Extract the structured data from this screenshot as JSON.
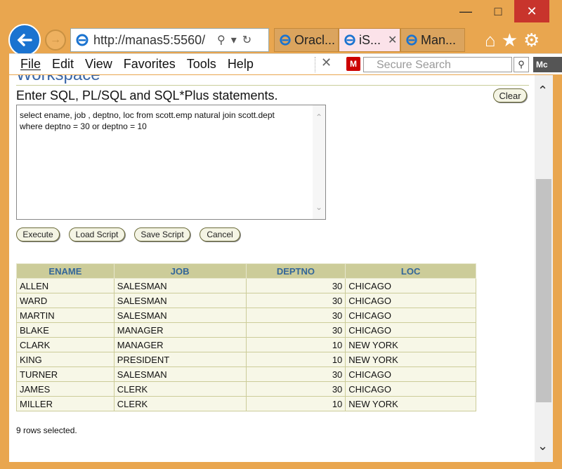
{
  "browser": {
    "address": "http://manas5:5560/",
    "tabs": [
      {
        "label": "Oracl..."
      },
      {
        "label": "iS..."
      },
      {
        "label": "Man..."
      }
    ],
    "menu": [
      {
        "label": "File"
      },
      {
        "label": "Edit"
      },
      {
        "label": "View"
      },
      {
        "label": "Favorites"
      },
      {
        "label": "Tools"
      },
      {
        "label": "Help"
      }
    ],
    "search_placeholder": "Secure Search",
    "mcafee_badge": "Mc"
  },
  "page": {
    "workspace_title": "Workspace",
    "prompt": "Enter SQL, PL/SQL and SQL*Plus statements.",
    "clear_label": "Clear",
    "sql": "select ename, job , deptno, loc from scott.emp natural join scott.dept\nwhere deptno = 30 or deptno = 10",
    "buttons": {
      "execute": "Execute",
      "load": "Load Script",
      "save": "Save Script",
      "cancel": "Cancel"
    },
    "table": {
      "headers": [
        "ENAME",
        "JOB",
        "DEPTNO",
        "LOC"
      ],
      "rows": [
        [
          "ALLEN",
          "SALESMAN",
          "30",
          "CHICAGO"
        ],
        [
          "WARD",
          "SALESMAN",
          "30",
          "CHICAGO"
        ],
        [
          "MARTIN",
          "SALESMAN",
          "30",
          "CHICAGO"
        ],
        [
          "BLAKE",
          "MANAGER",
          "30",
          "CHICAGO"
        ],
        [
          "CLARK",
          "MANAGER",
          "10",
          "NEW YORK"
        ],
        [
          "KING",
          "PRESIDENT",
          "10",
          "NEW YORK"
        ],
        [
          "TURNER",
          "SALESMAN",
          "30",
          "CHICAGO"
        ],
        [
          "JAMES",
          "CLERK",
          "30",
          "CHICAGO"
        ],
        [
          "MILLER",
          "CLERK",
          "10",
          "NEW YORK"
        ]
      ]
    },
    "rows_selected": "9 rows selected."
  },
  "colors": {
    "frame": "#e9a64f",
    "header_bg": "#cccc99",
    "header_text": "#336699",
    "cell_bg": "#f7f7e7"
  }
}
